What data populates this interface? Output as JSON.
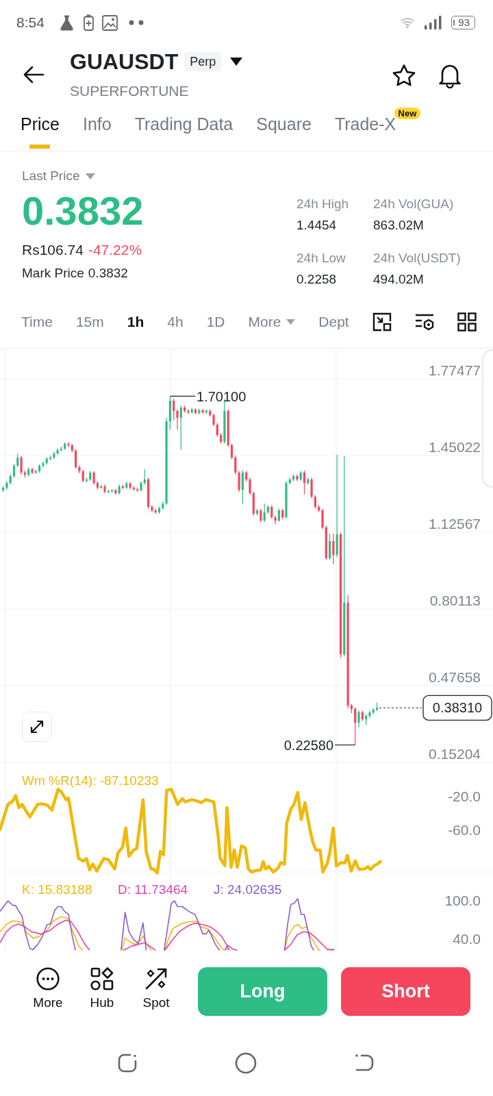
{
  "status_bar": {
    "time": "8:54",
    "battery": "93"
  },
  "header": {
    "symbol": "GUAUSDT",
    "badge": "Perp",
    "subtitle": "SUPERFORTUNE"
  },
  "tabs": [
    {
      "label": "Price",
      "selected": true
    },
    {
      "label": "Info",
      "selected": false
    },
    {
      "label": "Trading Data",
      "selected": false
    },
    {
      "label": "Square",
      "selected": false
    },
    {
      "label": "Trade-X",
      "selected": false,
      "badge": "New"
    }
  ],
  "price": {
    "label": "Last Price",
    "value": "0.3832",
    "fiat": "Rs106.74",
    "change": "-47.22%",
    "mark": {
      "label": "Mark Price",
      "value": "0.3832"
    }
  },
  "stats": [
    {
      "label": "24h High",
      "value": "1.4454"
    },
    {
      "label": "24h Vol(GUA)",
      "value": "863.02M"
    },
    {
      "label": "24h Low",
      "value": "0.2258"
    },
    {
      "label": "24h Vol(USDT)",
      "value": "494.02M"
    }
  ],
  "intervals": [
    {
      "label": "Time",
      "selected": false,
      "dropdown": false
    },
    {
      "label": "15m",
      "selected": false,
      "dropdown": false
    },
    {
      "label": "1h",
      "selected": true,
      "dropdown": false
    },
    {
      "label": "4h",
      "selected": false,
      "dropdown": false
    },
    {
      "label": "1D",
      "selected": false,
      "dropdown": false
    },
    {
      "label": "More",
      "selected": false,
      "dropdown": true
    },
    {
      "label": "Dept",
      "selected": false,
      "dropdown": false
    }
  ],
  "chart": {
    "chart_data": {
      "type": "candlestick",
      "grid": true,
      "ohlc": [
        [
          1.303,
          1.322,
          1.297,
          1.314
        ],
        [
          1.314,
          1.342,
          1.305,
          1.334
        ],
        [
          1.334,
          1.371,
          1.328,
          1.363
        ],
        [
          1.363,
          1.415,
          1.356,
          1.407
        ],
        [
          1.407,
          1.459,
          1.401,
          1.442
        ],
        [
          1.442,
          1.449,
          1.37,
          1.378
        ],
        [
          1.378,
          1.386,
          1.358,
          1.369
        ],
        [
          1.369,
          1.4,
          1.362,
          1.392
        ],
        [
          1.392,
          1.398,
          1.371,
          1.378
        ],
        [
          1.378,
          1.391,
          1.372,
          1.384
        ],
        [
          1.384,
          1.413,
          1.378,
          1.407
        ],
        [
          1.407,
          1.425,
          1.4,
          1.418
        ],
        [
          1.418,
          1.444,
          1.412,
          1.436
        ],
        [
          1.436,
          1.45,
          1.43,
          1.442
        ],
        [
          1.442,
          1.466,
          1.436,
          1.459
        ],
        [
          1.459,
          1.481,
          1.452,
          1.473
        ],
        [
          1.473,
          1.488,
          1.468,
          1.479
        ],
        [
          1.479,
          1.507,
          1.474,
          1.5
        ],
        [
          1.5,
          1.506,
          1.486,
          1.494
        ],
        [
          1.494,
          1.499,
          1.465,
          1.471
        ],
        [
          1.471,
          1.476,
          1.394,
          1.401
        ],
        [
          1.401,
          1.409,
          1.375,
          1.384
        ],
        [
          1.384,
          1.39,
          1.337,
          1.343
        ],
        [
          1.343,
          1.356,
          1.336,
          1.349
        ],
        [
          1.349,
          1.385,
          1.344,
          1.378
        ],
        [
          1.378,
          1.384,
          1.327,
          1.334
        ],
        [
          1.334,
          1.34,
          1.306,
          1.314
        ],
        [
          1.314,
          1.328,
          1.309,
          1.32
        ],
        [
          1.32,
          1.326,
          1.29,
          1.297
        ],
        [
          1.297,
          1.306,
          1.291,
          1.3
        ],
        [
          1.3,
          1.309,
          1.294,
          1.303
        ],
        [
          1.303,
          1.31,
          1.285,
          1.291
        ],
        [
          1.291,
          1.328,
          1.286,
          1.32
        ],
        [
          1.32,
          1.326,
          1.308,
          1.314
        ],
        [
          1.314,
          1.34,
          1.309,
          1.332
        ],
        [
          1.332,
          1.338,
          1.307,
          1.314
        ],
        [
          1.314,
          1.321,
          1.301,
          1.308
        ],
        [
          1.308,
          1.315,
          1.296,
          1.303
        ],
        [
          1.303,
          1.341,
          1.298,
          1.334
        ],
        [
          1.334,
          1.392,
          1.328,
          1.349
        ],
        [
          1.349,
          1.355,
          1.226,
          1.233
        ],
        [
          1.233,
          1.24,
          1.21,
          1.218
        ],
        [
          1.218,
          1.225,
          1.203,
          1.21
        ],
        [
          1.21,
          1.235,
          1.204,
          1.227
        ],
        [
          1.227,
          1.255,
          1.221,
          1.247
        ],
        [
          1.247,
          1.61,
          1.24,
          1.595
        ],
        [
          1.595,
          1.701,
          1.56,
          1.682
        ],
        [
          1.682,
          1.69,
          1.6,
          1.639
        ],
        [
          1.639,
          1.645,
          1.56,
          1.61
        ],
        [
          1.61,
          1.662,
          1.474,
          1.653
        ],
        [
          1.653,
          1.66,
          1.632,
          1.639
        ],
        [
          1.639,
          1.645,
          1.626,
          1.633
        ],
        [
          1.633,
          1.652,
          1.628,
          1.645
        ],
        [
          1.645,
          1.65,
          1.624,
          1.63
        ],
        [
          1.63,
          1.648,
          1.624,
          1.642
        ],
        [
          1.642,
          1.648,
          1.627,
          1.633
        ],
        [
          1.633,
          1.645,
          1.627,
          1.639
        ],
        [
          1.639,
          1.646,
          1.615,
          1.621
        ],
        [
          1.621,
          1.628,
          1.574,
          1.581
        ],
        [
          1.581,
          1.588,
          1.53,
          1.537
        ],
        [
          1.537,
          1.545,
          1.501,
          1.508
        ],
        [
          1.508,
          1.688,
          1.5,
          1.639
        ],
        [
          1.639,
          1.645,
          1.487,
          1.494
        ],
        [
          1.494,
          1.5,
          1.435,
          1.442
        ],
        [
          1.442,
          1.45,
          1.37,
          1.378
        ],
        [
          1.378,
          1.385,
          1.296,
          1.305
        ],
        [
          1.305,
          1.388,
          1.245,
          1.378
        ],
        [
          1.378,
          1.385,
          1.34,
          1.349
        ],
        [
          1.349,
          1.356,
          1.284,
          1.291
        ],
        [
          1.291,
          1.298,
          1.196,
          1.204
        ],
        [
          1.204,
          1.226,
          1.197,
          1.218
        ],
        [
          1.218,
          1.225,
          1.168,
          1.175
        ],
        [
          1.175,
          1.247,
          1.17,
          1.21
        ],
        [
          1.21,
          1.24,
          1.204,
          1.233
        ],
        [
          1.233,
          1.24,
          1.182,
          1.189
        ],
        [
          1.189,
          1.196,
          1.16,
          1.175
        ],
        [
          1.175,
          1.226,
          1.17,
          1.218
        ],
        [
          1.218,
          1.225,
          1.18,
          1.189
        ],
        [
          1.189,
          1.342,
          1.184,
          1.334
        ],
        [
          1.334,
          1.356,
          1.327,
          1.349
        ],
        [
          1.349,
          1.372,
          1.342,
          1.363
        ],
        [
          1.363,
          1.371,
          1.342,
          1.349
        ],
        [
          1.349,
          1.385,
          1.343,
          1.378
        ],
        [
          1.378,
          1.386,
          1.286,
          1.334
        ],
        [
          1.334,
          1.356,
          1.327,
          1.349
        ],
        [
          1.349,
          1.356,
          1.27,
          1.276
        ],
        [
          1.276,
          1.282,
          1.226,
          1.233
        ],
        [
          1.233,
          1.24,
          1.211,
          1.218
        ],
        [
          1.218,
          1.225,
          1.139,
          1.146
        ],
        [
          1.146,
          1.153,
          1.009,
          1.016
        ],
        [
          1.016,
          1.12,
          1.01,
          1.088
        ],
        [
          1.088,
          1.12,
          0.99,
          1.03
        ],
        [
          1.03,
          1.453,
          1.02,
          1.117
        ],
        [
          1.117,
          1.124,
          0.595,
          0.61
        ],
        [
          0.61,
          1.447,
          0.6,
          0.827
        ],
        [
          0.827,
          0.86,
          0.38,
          0.393
        ],
        [
          0.393,
          0.4,
          0.36,
          0.378
        ],
        [
          0.378,
          0.385,
          0.2258,
          0.32
        ],
        [
          0.32,
          0.372,
          0.3,
          0.364
        ],
        [
          0.364,
          0.37,
          0.327,
          0.335
        ],
        [
          0.335,
          0.356,
          0.31,
          0.349
        ],
        [
          0.349,
          0.371,
          0.34,
          0.364
        ],
        [
          0.364,
          0.382,
          0.355,
          0.375
        ],
        [
          0.375,
          0.405,
          0.369,
          0.383
        ]
      ],
      "ylim": [
        0.15204,
        1.90227
      ],
      "yticks": [
        {
          "value": 1.77477,
          "label": "1.77477"
        },
        {
          "value": 1.45022,
          "label": "1.45022"
        },
        {
          "value": 1.12567,
          "label": "1.12567"
        },
        {
          "value": 0.80113,
          "label": "0.80113"
        },
        {
          "value": 0.47658,
          "label": "0.47658"
        },
        {
          "value": 0.15204,
          "label": "0.15204"
        }
      ]
    },
    "high_label": "1.70100",
    "low_label": "0.22580",
    "last_price_tag": "0.38310"
  },
  "williams_r": {
    "label": "Wm %R(14): -87.10233",
    "axis": [
      "-20.0",
      "-60.0"
    ]
  },
  "kdj": {
    "legend": [
      {
        "text": "K: 15.83188",
        "color": "#f0b90b"
      },
      {
        "text": "D: 11.73464",
        "color": "#e83fae"
      },
      {
        "text": "J: 24.02635",
        "color": "#8a5cd0"
      }
    ],
    "axis": [
      "100.0",
      "40.0"
    ]
  },
  "actions": [
    {
      "label": "More",
      "kind": "more"
    },
    {
      "label": "Hub",
      "kind": "hub"
    },
    {
      "label": "Spot",
      "kind": "spot"
    }
  ],
  "trade_buttons": [
    {
      "label": "Long",
      "kind": "long"
    },
    {
      "label": "Short",
      "kind": "short"
    }
  ]
}
